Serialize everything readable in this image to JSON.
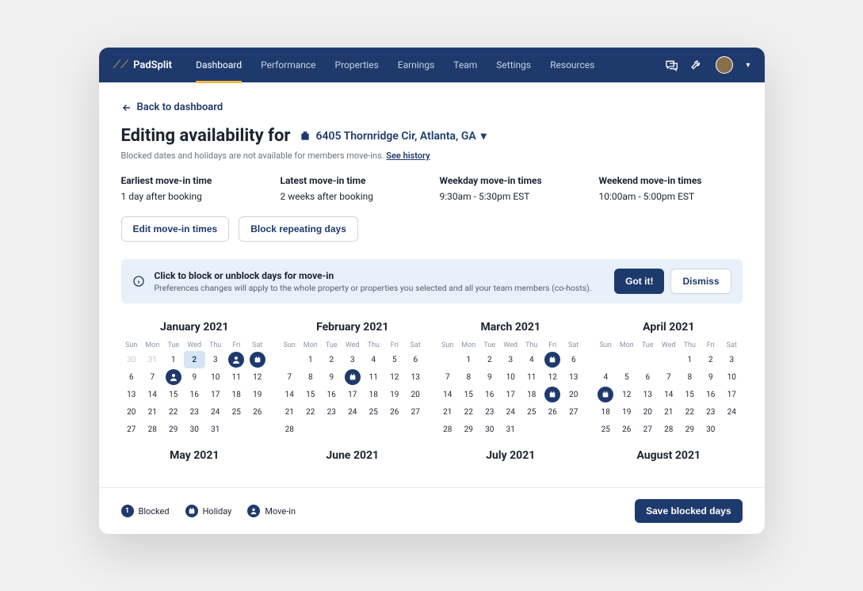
{
  "brand": "PadSplit",
  "nav": [
    "Dashboard",
    "Performance",
    "Properties",
    "Earnings",
    "Team",
    "Settings",
    "Resources"
  ],
  "navActive": 0,
  "back": "Back to dashboard",
  "pageTitle": "Editing availability for",
  "address": "6405 Thornridge Cir, Atlanta, GA",
  "note": "Blocked dates and holidays are not available for members move-ins.",
  "historyLink": "See history",
  "movein": [
    {
      "label": "Earliest move-in time",
      "value": "1 day after booking"
    },
    {
      "label": "Latest move-in time",
      "value": "2 weeks after booking"
    },
    {
      "label": "Weekday move-in times",
      "value": "9:30am - 5:30pm EST"
    },
    {
      "label": "Weekend move-in times",
      "value": "10:00am - 5:00pm EST"
    }
  ],
  "buttons": {
    "edit": "Edit move-in times",
    "block": "Block repeating days"
  },
  "banner": {
    "title": "Click to block or unblock days for move-in",
    "text": "Preferences changes will apply to the whole property or properties you  selected and all  your team members (co-hosts).",
    "gotit": "Got it!",
    "dismiss": "Dismiss"
  },
  "dow": [
    "Sun",
    "Mon",
    "Tue",
    "Wed",
    "Thu",
    "Fri",
    "Sat"
  ],
  "months": [
    {
      "title": "January 2021",
      "pre": [
        30,
        31
      ],
      "days": 31,
      "selected": [
        2
      ],
      "person": [
        4,
        8
      ],
      "cal": [
        5
      ]
    },
    {
      "title": "February 2021",
      "pre": [],
      "days": 28,
      "offset": 1,
      "cal": [
        10
      ]
    },
    {
      "title": "March 2021",
      "pre": [],
      "days": 31,
      "offset": 1,
      "cal": [
        5,
        19
      ]
    },
    {
      "title": "April 2021",
      "pre": [],
      "days": 30,
      "offset": 4,
      "cal": [
        11
      ]
    },
    {
      "title": "May 2021",
      "pre": [],
      "days": 0
    },
    {
      "title": "June 2021",
      "pre": [],
      "days": 0
    },
    {
      "title": "July 2021",
      "pre": [],
      "days": 0
    },
    {
      "title": "August 2021",
      "pre": [],
      "days": 0
    }
  ],
  "legend": [
    {
      "icon": "num",
      "text": "Blocked"
    },
    {
      "icon": "cal",
      "text": "Holiday"
    },
    {
      "icon": "person",
      "text": "Move-in"
    }
  ],
  "save": "Save blocked days"
}
